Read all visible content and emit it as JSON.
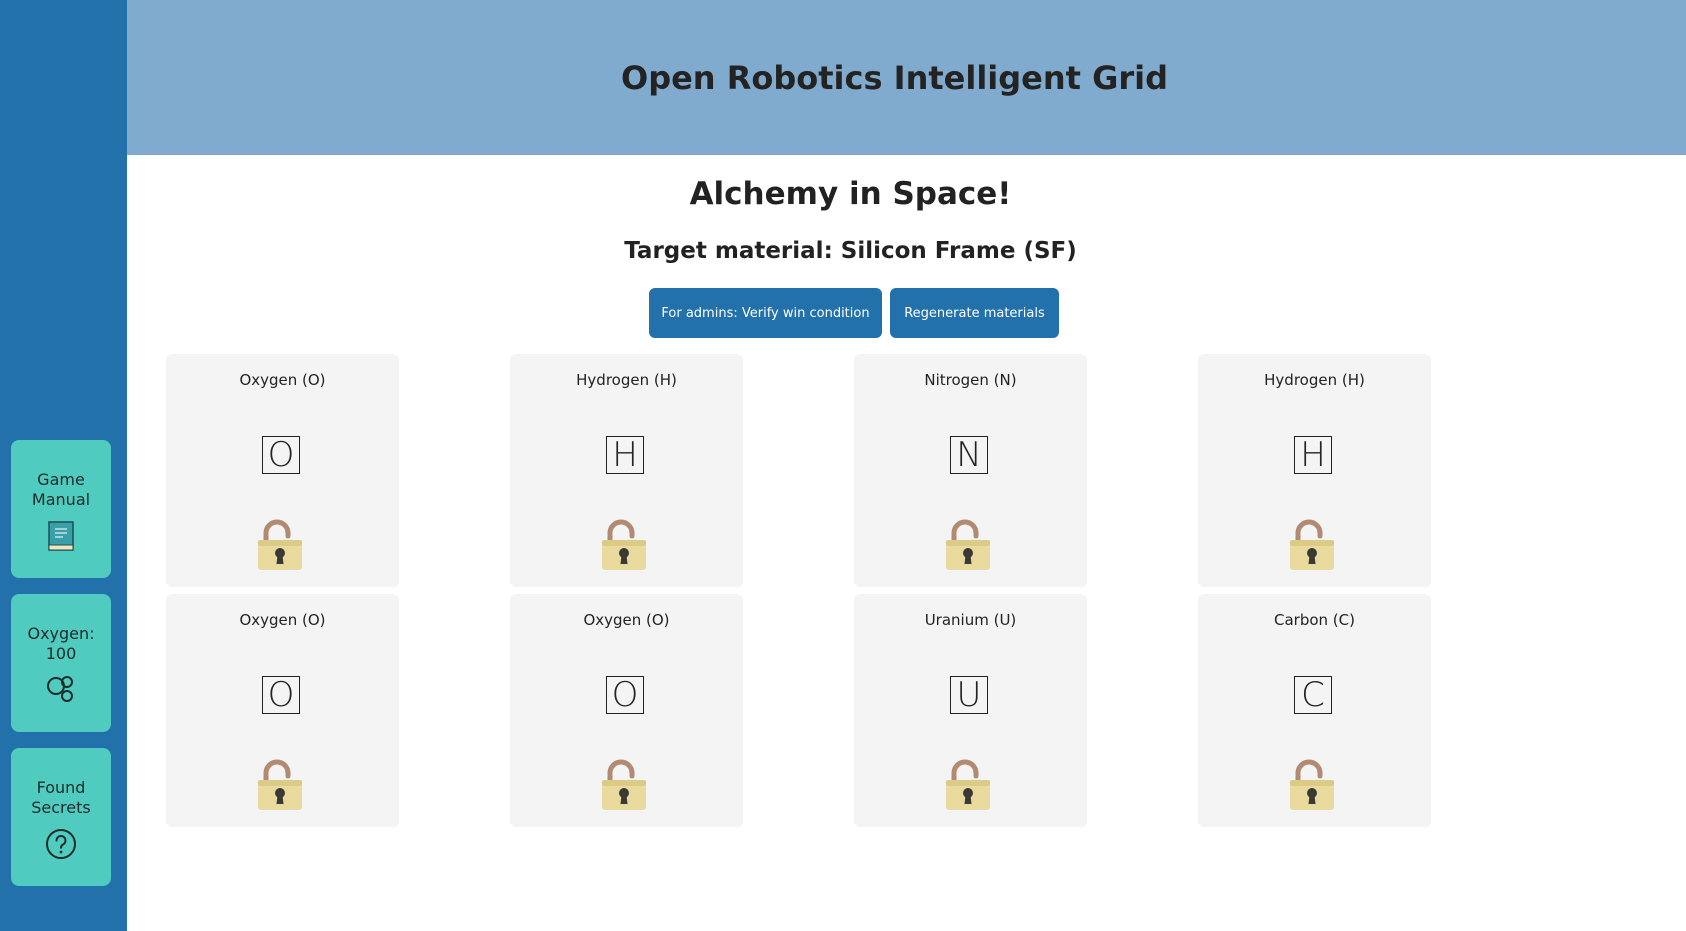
{
  "sidebar": {
    "items": [
      {
        "label": "Game\nManual",
        "icon": "book-icon"
      },
      {
        "label": "Oxygen:\n100",
        "icon": "oxygen-molecule-icon"
      },
      {
        "label": "Found\nSecrets",
        "icon": "question-circle-icon"
      }
    ]
  },
  "header": {
    "title": "Open Robotics Intelligent Grid"
  },
  "main": {
    "subtitle": "Alchemy in Space!",
    "target": "Target material: Silicon Frame (SF)",
    "buttons": {
      "verify": "For admins: Verify win condition",
      "regenerate": "Regenerate materials"
    },
    "tiles": [
      {
        "name": "Oxygen (O)",
        "symbol": "O",
        "lock": "unlocked-padlock-icon"
      },
      {
        "name": "Hydrogen (H)",
        "symbol": "H",
        "lock": "unlocked-padlock-icon"
      },
      {
        "name": "Nitrogen (N)",
        "symbol": "N",
        "lock": "unlocked-padlock-icon"
      },
      {
        "name": "Hydrogen (H)",
        "symbol": "H",
        "lock": "unlocked-padlock-icon"
      },
      {
        "name": "Oxygen (O)",
        "symbol": "O",
        "lock": "unlocked-padlock-icon"
      },
      {
        "name": "Oxygen (O)",
        "symbol": "O",
        "lock": "unlocked-padlock-icon"
      },
      {
        "name": "Uranium (U)",
        "symbol": "U",
        "lock": "unlocked-padlock-icon"
      },
      {
        "name": "Carbon (C)",
        "symbol": "C",
        "lock": "unlocked-padlock-icon"
      }
    ]
  },
  "colors": {
    "sidebar": "#2271ab",
    "sidebar_card": "#4fcbbf",
    "header": "#80abcf",
    "button": "#2271ab",
    "tile": "#f4f4f4"
  }
}
